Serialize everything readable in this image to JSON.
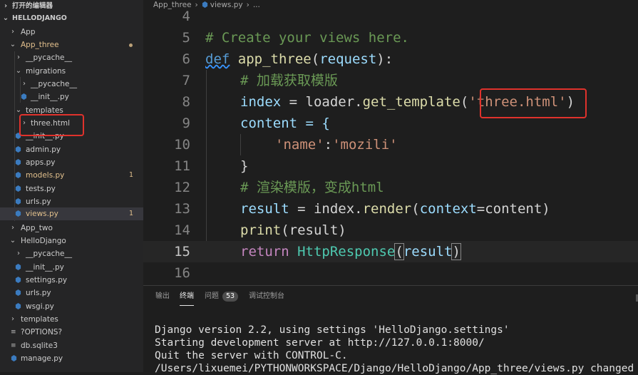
{
  "sidebar": {
    "open_editors": "打开的编辑器",
    "project": "HELLODJANGO",
    "items": [
      {
        "label": "App",
        "badge": ""
      },
      {
        "label": "App_three",
        "badge": ""
      },
      {
        "label": "__pycache__",
        "badge": ""
      },
      {
        "label": "migrations",
        "badge": ""
      },
      {
        "label": "__pycache__",
        "badge": ""
      },
      {
        "label": "__init__.py",
        "badge": ""
      },
      {
        "label": "templates",
        "badge": ""
      },
      {
        "label": "three.html",
        "badge": ""
      },
      {
        "label": "__init__.py",
        "badge": ""
      },
      {
        "label": "admin.py",
        "badge": ""
      },
      {
        "label": "apps.py",
        "badge": ""
      },
      {
        "label": "models.py",
        "badge": "1"
      },
      {
        "label": "tests.py",
        "badge": ""
      },
      {
        "label": "urls.py",
        "badge": ""
      },
      {
        "label": "views.py",
        "badge": "1"
      },
      {
        "label": "App_two",
        "badge": ""
      },
      {
        "label": "HelloDjango",
        "badge": ""
      },
      {
        "label": "__pycache__",
        "badge": ""
      },
      {
        "label": "__init__.py",
        "badge": ""
      },
      {
        "label": "settings.py",
        "badge": ""
      },
      {
        "label": "urls.py",
        "badge": ""
      },
      {
        "label": "wsgi.py",
        "badge": ""
      },
      {
        "label": "templates",
        "badge": ""
      },
      {
        "label": "?OPTIONS?",
        "badge": ""
      },
      {
        "label": "db.sqlite3",
        "badge": ""
      },
      {
        "label": "manage.py",
        "badge": ""
      }
    ]
  },
  "editor": {
    "breadcrumb": [
      "App_three",
      "views.py",
      "..."
    ],
    "line_numbers": [
      "4",
      "5",
      "6",
      "7",
      "8",
      "9",
      "10",
      "11",
      "12",
      "13",
      "14",
      "15",
      "16"
    ],
    "code": {
      "l5_comment": "# Create your views here.",
      "l6_def": "def",
      "l6_name": "app_three",
      "l6_open": "(",
      "l6_param": "request",
      "l6_close": "):",
      "l7_comment": "# 加载获取模版",
      "l8_var": "index",
      "l8_eq": " = loader.",
      "l8_fn": "get_template",
      "l8_open": "(",
      "l8_str": "'three.html'",
      "l8_close": ")",
      "l9_text": "content = {",
      "l10_key": "'name'",
      "l10_colon": ":",
      "l10_val": "'mozili'",
      "l11_text": "}",
      "l12_comment": "# 渲染模版，变成html",
      "l13_var": "result",
      "l13_eq": " = index.",
      "l13_fn": "render",
      "l13_open": "(",
      "l13_kw": "context",
      "l13_rest": "=content)",
      "l14_fn": "print",
      "l14_rest": "(result)",
      "l15_kw": "return",
      "l15_cls": " HttpResponse",
      "l15_open": "(",
      "l15_arg": "result",
      "l15_close": ")"
    }
  },
  "panel": {
    "tabs": [
      "输出",
      "终端",
      "问题",
      "调试控制台"
    ],
    "problems_count": "53",
    "terminal": [
      "Django version 2.2, using settings 'HelloDjango.settings'",
      "Starting development server at http://127.0.0.1:8000/",
      "Quit the server with CONTROL-C.",
      "/Users/lixuemei/PYTHONWORKSPACE/Django/HelloDjango/App_three/views.py changed"
    ]
  },
  "colors": {
    "highlight": "#e0322c",
    "modified": "#e2c08d",
    "python_icon": "#3b7bbf"
  }
}
